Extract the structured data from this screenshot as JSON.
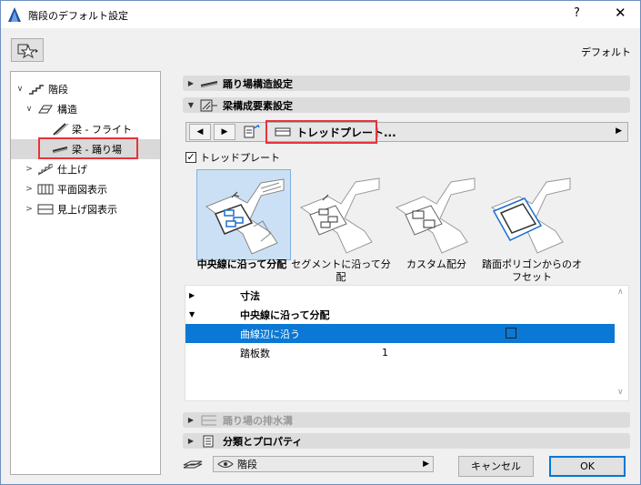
{
  "window": {
    "title": "階段のデフォルト設定",
    "help_glyph": "?",
    "close_glyph": "✕"
  },
  "header": {
    "default_label": "デフォルト"
  },
  "tree": {
    "items": [
      {
        "label": "階段",
        "expander": "∨"
      },
      {
        "label": "構造",
        "expander": "∨"
      },
      {
        "label": "梁 - フライト",
        "expander": ""
      },
      {
        "label": "梁 - 踊り場",
        "expander": ""
      },
      {
        "label": "仕上げ",
        "expander": ">"
      },
      {
        "label": "平面図表示",
        "expander": ">"
      },
      {
        "label": "見上げ図表示",
        "expander": ">"
      }
    ]
  },
  "panels": {
    "landing_structure": {
      "label": "踊り場構造設定",
      "tri": "▶"
    },
    "beam_elements": {
      "label": "梁構成要素設定",
      "tri": "▼"
    },
    "drainage": {
      "label": "踊り場の排水溝",
      "tri": "▶"
    },
    "classification": {
      "label": "分類とプロパティ",
      "tri": "▶"
    }
  },
  "navbar": {
    "prev": "◀",
    "next": "▶",
    "selector_label": "トレッドプレート...",
    "selector_arrow": "▶"
  },
  "tread_plate": {
    "label": "トレッドプレート",
    "checked": "✓"
  },
  "options": [
    {
      "label": "中央線に沿って分配"
    },
    {
      "label": "セグメントに沿って分配"
    },
    {
      "label": "カスタム配分"
    },
    {
      "label": "踏面ポリゴンからのオフセット"
    }
  ],
  "table": {
    "rows": [
      {
        "tri": "▶",
        "label": "寸法",
        "value": ""
      },
      {
        "tri": "▼",
        "label": "中央線に沿って分配",
        "value": ""
      },
      {
        "tri": "",
        "label": "曲線辺に沿う",
        "value": ""
      },
      {
        "tri": "",
        "label": "踏板数",
        "value": "1"
      }
    ],
    "scroll_up": "∧",
    "scroll_down": "∨"
  },
  "footer": {
    "view_label": "階段",
    "view_arrow": "▶",
    "cancel_label": "キャンセル",
    "ok_label": "OK"
  },
  "colors": {
    "accent": "#0a78d4",
    "highlight_box": "#e8333b",
    "selected_thumb": "#cce0f5"
  }
}
